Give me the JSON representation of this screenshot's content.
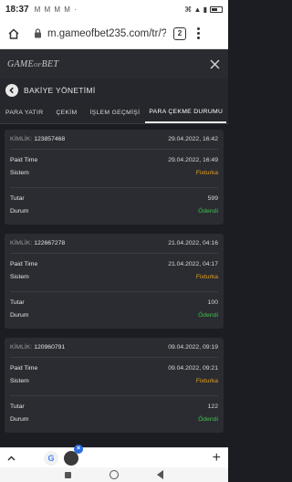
{
  "status_bar": {
    "time": "18:37",
    "indicators": "M M M M ·",
    "right_text": "⌘ ▲ ▮"
  },
  "browser": {
    "url": "m.gameofbet235.com/tr/?pr",
    "tab_count": "2"
  },
  "site": {
    "logo_a": "GAME",
    "logo_b": "OF",
    "logo_c": "BET"
  },
  "page": {
    "title": "BAKİYE YÖNETİMİ"
  },
  "tabs": [
    {
      "label": "PARA YATIR"
    },
    {
      "label": "ÇEKİM"
    },
    {
      "label": "İŞLEM GEÇMİŞİ"
    },
    {
      "label": "PARA ÇEKME DURUMU"
    }
  ],
  "labels": {
    "kimlik": "KİMLİK:",
    "paid_time": "Paid Time",
    "sistem": "Sistem",
    "tutar": "Tutar",
    "durum": "Durum"
  },
  "records": [
    {
      "id": "123857468",
      "date": "29.04.2022, 16:42",
      "paid_time": "29.04.2022, 16:49",
      "sistem": "Fixturka",
      "tutar": "599",
      "durum": "Ödendi"
    },
    {
      "id": "122667278",
      "date": "21.04.2022, 04:16",
      "paid_time": "21.04.2022, 04:17",
      "sistem": "Fixturka",
      "tutar": "100",
      "durum": "Ödendi"
    },
    {
      "id": "120960791",
      "date": "09.04.2022, 09:19",
      "paid_time": "09.04.2022, 09:21",
      "sistem": "Fixturka",
      "tutar": "122",
      "durum": "Ödendi"
    }
  ],
  "bottom_bar": {
    "g_label": "G"
  },
  "colors": {
    "accent_orange": "#e0a020",
    "status_green": "#3cc24a",
    "panel": "#2b2c31",
    "background": "#1c1d22"
  }
}
